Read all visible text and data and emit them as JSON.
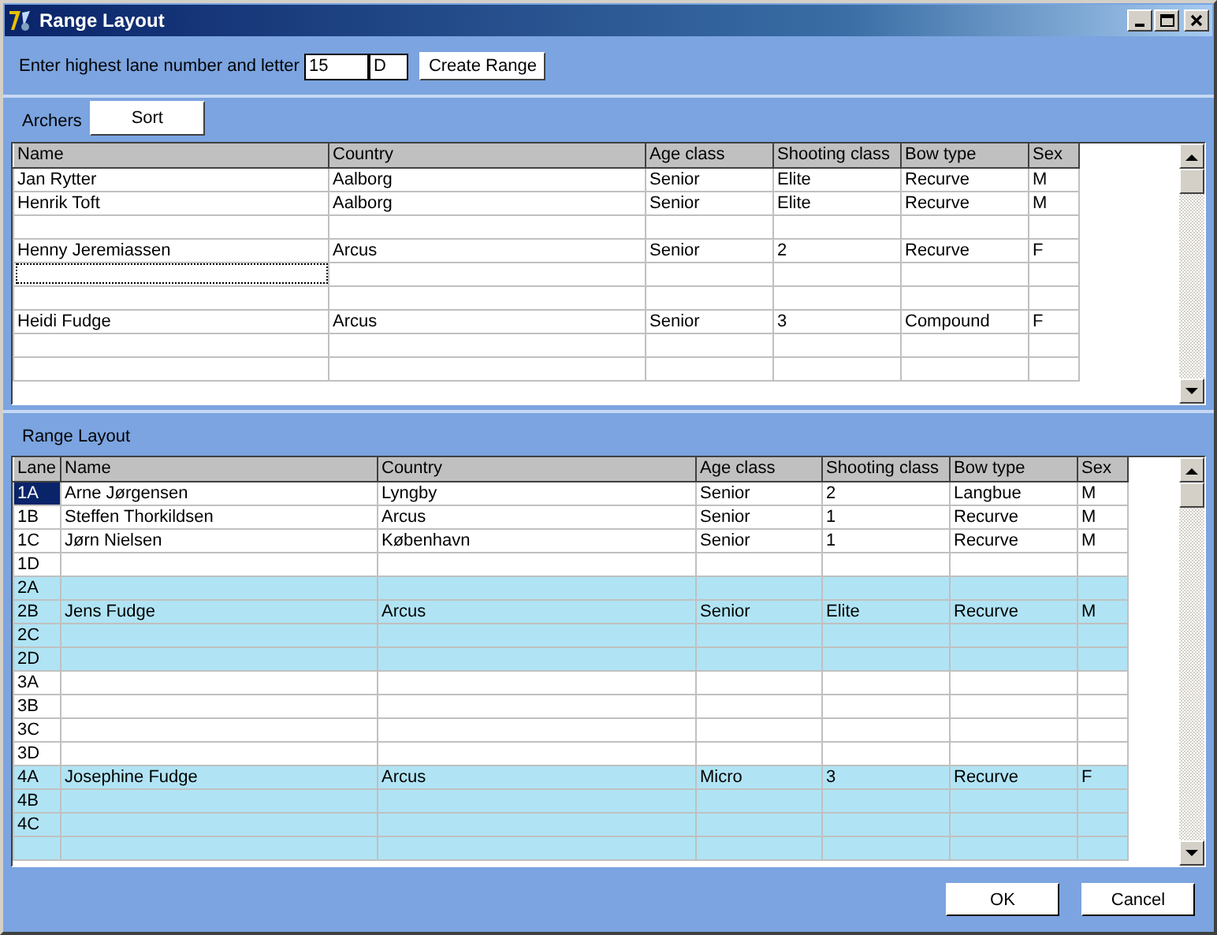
{
  "window": {
    "title": "Range Layout"
  },
  "lane_entry": {
    "label": "Enter highest lane number and letter",
    "number": "15",
    "letter": "D",
    "button": "Create Range"
  },
  "archers": {
    "label": "Archers",
    "sort_button": "Sort",
    "columns": [
      "Name",
      "Country",
      "Age class",
      "Shooting class",
      "Bow type",
      "Sex"
    ],
    "rows": [
      {
        "kind": "filled",
        "focused": false,
        "cells": [
          "Jan Rytter",
          "Aalborg",
          "Senior",
          "Elite",
          "Recurve",
          "M"
        ]
      },
      {
        "kind": "filled",
        "focused": false,
        "cells": [
          "Henrik Toft",
          "Aalborg",
          "Senior",
          "Elite",
          "Recurve",
          "M"
        ]
      },
      {
        "kind": "empty",
        "focused": false
      },
      {
        "kind": "filled",
        "focused": false,
        "cells": [
          "Henny Jeremiassen",
          "Arcus",
          "Senior",
          "2",
          "Recurve",
          "F"
        ]
      },
      {
        "kind": "empty",
        "focused": true
      },
      {
        "kind": "empty",
        "focused": false
      },
      {
        "kind": "filled",
        "focused": false,
        "cells": [
          "Heidi Fudge",
          "Arcus",
          "Senior",
          "3",
          "Compound",
          "F"
        ]
      },
      {
        "kind": "empty",
        "focused": false
      },
      {
        "kind": "empty",
        "focused": false
      }
    ]
  },
  "range_layout": {
    "label": "Range Layout",
    "columns": [
      "Lane",
      "Name",
      "Country",
      "Age class",
      "Shooting class",
      "Bow type",
      "Sex"
    ],
    "rows": [
      {
        "lane": "1A",
        "selected": true,
        "shaded": false,
        "cells": [
          "Arne Jørgensen",
          "Lyngby",
          "Senior",
          "2",
          "Langbue",
          "M"
        ]
      },
      {
        "lane": "1B",
        "selected": false,
        "shaded": false,
        "cells": [
          "Steffen Thorkildsen",
          "Arcus",
          "Senior",
          "1",
          "Recurve",
          "M"
        ]
      },
      {
        "lane": "1C",
        "selected": false,
        "shaded": false,
        "cells": [
          "Jørn Nielsen",
          "København",
          "Senior",
          "1",
          "Recurve",
          "M"
        ]
      },
      {
        "lane": "1D",
        "selected": false,
        "shaded": false
      },
      {
        "lane": "2A",
        "selected": false,
        "shaded": true
      },
      {
        "lane": "2B",
        "selected": false,
        "shaded": true,
        "cells": [
          "Jens Fudge",
          "Arcus",
          "Senior",
          "Elite",
          "Recurve",
          "M"
        ]
      },
      {
        "lane": "2C",
        "selected": false,
        "shaded": true
      },
      {
        "lane": "2D",
        "selected": false,
        "shaded": true
      },
      {
        "lane": "3A",
        "selected": false,
        "shaded": false
      },
      {
        "lane": "3B",
        "selected": false,
        "shaded": false
      },
      {
        "lane": "3C",
        "selected": false,
        "shaded": false
      },
      {
        "lane": "3D",
        "selected": false,
        "shaded": false
      },
      {
        "lane": "4A",
        "selected": false,
        "shaded": true,
        "cells": [
          "Josephine Fudge",
          "Arcus",
          "Micro",
          "3",
          "Recurve",
          "F"
        ]
      },
      {
        "lane": "4B",
        "selected": false,
        "shaded": true
      },
      {
        "lane": "4C",
        "selected": false,
        "shaded": true
      },
      {
        "selected": false,
        "shaded": true
      }
    ]
  },
  "buttons": [
    "OK",
    "Cancel"
  ]
}
